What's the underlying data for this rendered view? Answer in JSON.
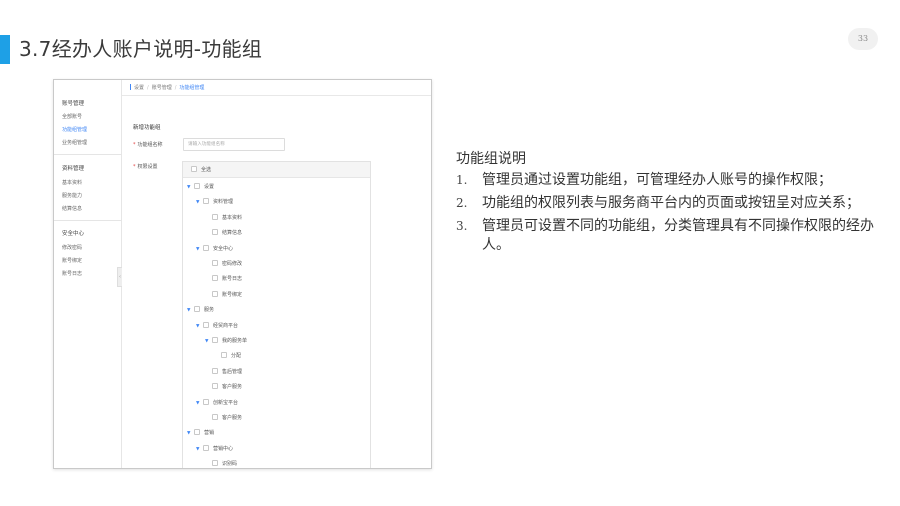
{
  "slide": {
    "title": "3.7经办人账户说明-功能组",
    "page_number": "33",
    "accent_color": "#1ea0e6"
  },
  "app": {
    "sidebar": {
      "groups": [
        {
          "label": "账号管理",
          "items": [
            {
              "label": "全部账号",
              "active": false
            },
            {
              "label": "功能组管理",
              "active": true
            },
            {
              "label": "业务组管理",
              "active": false
            }
          ]
        },
        {
          "label": "资料管理",
          "items": [
            {
              "label": "基本资料",
              "active": false
            },
            {
              "label": "服务能力",
              "active": false
            },
            {
              "label": "结算信息",
              "active": false
            }
          ]
        },
        {
          "label": "安全中心",
          "items": [
            {
              "label": "修改密码",
              "active": false
            },
            {
              "label": "账号绑定",
              "active": false
            },
            {
              "label": "账号日志",
              "active": false
            }
          ]
        }
      ]
    },
    "breadcrumb": {
      "items": [
        "设置",
        "账号管理",
        "功能组管理"
      ]
    },
    "form": {
      "title": "新增功能组",
      "name_label": "功能组名称",
      "name_placeholder": "请输入功能组名称",
      "perm_label": "权限设置",
      "required_mark": "*",
      "select_all": "全选",
      "tree": [
        {
          "label": "设置",
          "level": 0,
          "expanded": true
        },
        {
          "label": "资料管理",
          "level": 1,
          "expanded": true
        },
        {
          "label": "基本资料",
          "level": 2,
          "expanded": false
        },
        {
          "label": "结算信息",
          "level": 2,
          "expanded": false
        },
        {
          "label": "安全中心",
          "level": 1,
          "expanded": true
        },
        {
          "label": "密码修改",
          "level": 2,
          "expanded": false
        },
        {
          "label": "账号日志",
          "level": 2,
          "expanded": false
        },
        {
          "label": "账号绑定",
          "level": 2,
          "expanded": false
        },
        {
          "label": "服务",
          "level": 0,
          "expanded": true
        },
        {
          "label": "经贸商平台",
          "level": 1,
          "expanded": true
        },
        {
          "label": "我的服务单",
          "level": 2,
          "expanded": true
        },
        {
          "label": "分配",
          "level": 3,
          "expanded": false
        },
        {
          "label": "售后管理",
          "level": 2,
          "expanded": false
        },
        {
          "label": "客户服务",
          "level": 2,
          "expanded": false
        },
        {
          "label": "创新宝平台",
          "level": 1,
          "expanded": true
        },
        {
          "label": "客户服务",
          "level": 2,
          "expanded": false
        },
        {
          "label": "营销",
          "level": 0,
          "expanded": true
        },
        {
          "label": "营销中心",
          "level": 1,
          "expanded": true
        },
        {
          "label": "识别码",
          "level": 2,
          "expanded": false
        }
      ]
    }
  },
  "notes": {
    "title": "功能组说明",
    "items": [
      {
        "num": "1.",
        "text": "管理员通过设置功能组，可管理经办人账号的操作权限；"
      },
      {
        "num": "2.",
        "text": "功能组的权限列表与服务商平台内的页面或按钮呈对应关系；"
      },
      {
        "num": "3.",
        "text": "管理员可设置不同的功能组，分类管理具有不同操作权限的经办人。"
      }
    ]
  }
}
